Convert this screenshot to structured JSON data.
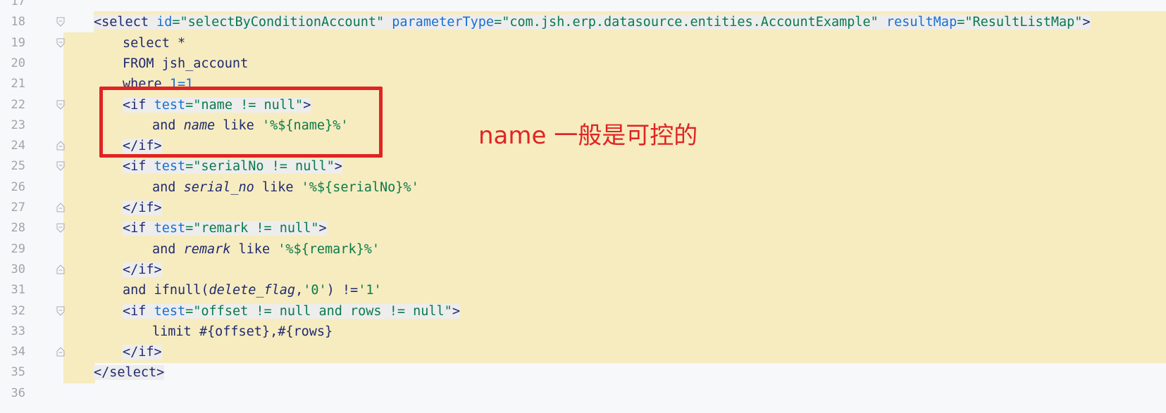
{
  "editor": {
    "lines": [
      {
        "num": "17",
        "parts": []
      },
      {
        "num": "18",
        "parts": [
          {
            "t": "<select ",
            "c": "kw tagbg"
          },
          {
            "t": "id",
            "c": "attr tagbg"
          },
          {
            "t": "=\"selectByConditionAccount\" ",
            "c": "str tagbg"
          },
          {
            "t": "parameterType",
            "c": "attr tagbg"
          },
          {
            "t": "=\"com.jsh.erp.datasource.entities.AccountExample\" ",
            "c": "str tagbg"
          },
          {
            "t": "resultMap",
            "c": "attr tagbg"
          },
          {
            "t": "=\"ResultListMap\"",
            "c": "str tagbg"
          },
          {
            "t": ">",
            "c": "kw tagbg"
          }
        ]
      },
      {
        "num": "19",
        "parts": [
          {
            "t": "select *",
            "c": "plain"
          }
        ]
      },
      {
        "num": "20",
        "parts": [
          {
            "t": "FROM jsh_account",
            "c": "plain"
          }
        ]
      },
      {
        "num": "21",
        "parts": [
          {
            "t": "where ",
            "c": "plain"
          },
          {
            "t": "1=1",
            "c": "num"
          }
        ]
      },
      {
        "num": "22",
        "parts": [
          {
            "t": "<if ",
            "c": "kw tagbg"
          },
          {
            "t": "test",
            "c": "attr tagbg"
          },
          {
            "t": "=\"name != null\"",
            "c": "str tagbg"
          },
          {
            "t": ">",
            "c": "kw tagbg"
          }
        ]
      },
      {
        "num": "23",
        "parts": [
          {
            "t": "and ",
            "c": "plain"
          },
          {
            "t": "name",
            "c": "it"
          },
          {
            "t": " like ",
            "c": "plain"
          },
          {
            "t": "'%${name}%'",
            "c": "str"
          }
        ]
      },
      {
        "num": "24",
        "parts": [
          {
            "t": "</if>",
            "c": "kw tagbg"
          }
        ]
      },
      {
        "num": "25",
        "parts": [
          {
            "t": "<if ",
            "c": "kw tagbg"
          },
          {
            "t": "test",
            "c": "attr tagbg"
          },
          {
            "t": "=\"serialNo != null\"",
            "c": "str tagbg"
          },
          {
            "t": ">",
            "c": "kw tagbg"
          }
        ]
      },
      {
        "num": "26",
        "parts": [
          {
            "t": "and ",
            "c": "plain"
          },
          {
            "t": "serial_no",
            "c": "it"
          },
          {
            "t": " like ",
            "c": "plain"
          },
          {
            "t": "'%${serialNo}%'",
            "c": "str"
          }
        ]
      },
      {
        "num": "27",
        "parts": [
          {
            "t": "</if>",
            "c": "kw tagbg"
          }
        ]
      },
      {
        "num": "28",
        "parts": [
          {
            "t": "<if ",
            "c": "kw tagbg"
          },
          {
            "t": "test",
            "c": "attr tagbg"
          },
          {
            "t": "=\"remark != null\"",
            "c": "str tagbg"
          },
          {
            "t": ">",
            "c": "kw tagbg"
          }
        ]
      },
      {
        "num": "29",
        "parts": [
          {
            "t": "and ",
            "c": "plain"
          },
          {
            "t": "remark",
            "c": "it"
          },
          {
            "t": " like ",
            "c": "plain"
          },
          {
            "t": "'%${remark}%'",
            "c": "str"
          }
        ]
      },
      {
        "num": "30",
        "parts": [
          {
            "t": "</if>",
            "c": "kw tagbg"
          }
        ]
      },
      {
        "num": "31",
        "parts": [
          {
            "t": "and ifnull(",
            "c": "plain"
          },
          {
            "t": "delete_flag",
            "c": "it"
          },
          {
            "t": ",",
            "c": "plain"
          },
          {
            "t": "'0'",
            "c": "str"
          },
          {
            "t": ") !=",
            "c": "plain"
          },
          {
            "t": "'1'",
            "c": "str"
          }
        ]
      },
      {
        "num": "32",
        "parts": [
          {
            "t": "<if ",
            "c": "kw tagbg"
          },
          {
            "t": "test",
            "c": "attr tagbg"
          },
          {
            "t": "=\"offset != null and rows != null\"",
            "c": "str tagbg"
          },
          {
            "t": ">",
            "c": "kw tagbg"
          }
        ]
      },
      {
        "num": "33",
        "parts": [
          {
            "t": "limit #{offset},#{rows}",
            "c": "plain"
          }
        ]
      },
      {
        "num": "34",
        "parts": [
          {
            "t": "</if>",
            "c": "kw tagbg"
          }
        ]
      },
      {
        "num": "35",
        "parts": [
          {
            "t": "</select>",
            "c": "kw tagbg"
          }
        ]
      },
      {
        "num": "36",
        "parts": []
      }
    ]
  },
  "annotation": {
    "text": "name 一般是可控的",
    "color": "#e02424"
  },
  "colors": {
    "highlight": "#f6ecc0",
    "gutter": "#f7f8fa",
    "attribute": "#1a6fd0",
    "string": "#0a7a4a",
    "keyword": "#1f2a70"
  }
}
